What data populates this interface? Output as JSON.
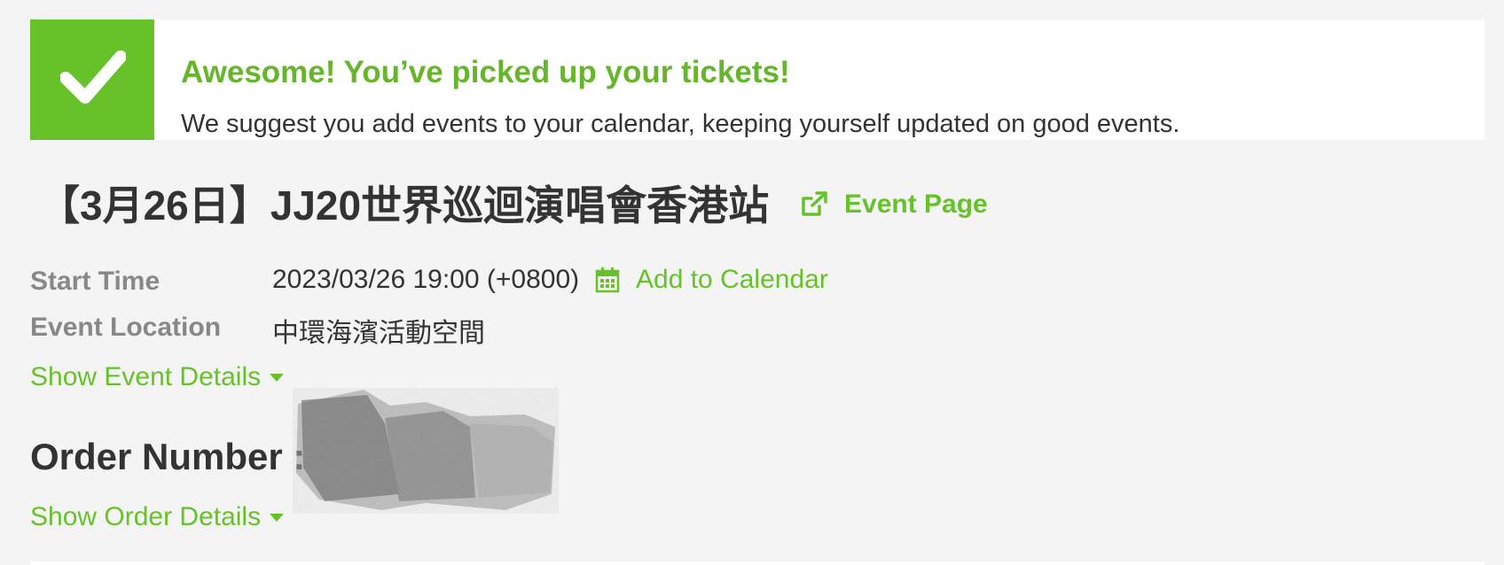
{
  "banner": {
    "heading": "Awesome! You’ve picked up your tickets!",
    "subtext": "We suggest you add events to your calendar, keeping yourself updated on good events.",
    "icon": "check-icon",
    "accent_color": "#67c22a"
  },
  "event": {
    "title": "【3月26日】JJ20世界巡迴演唱會香港站",
    "page_link_label": "Event Page",
    "page_link_icon": "external-link-icon"
  },
  "info": {
    "start_time_label": "Start Time",
    "start_time_value": "2023/03/26 19:00 (+0800)",
    "add_calendar_label": "Add to Calendar",
    "add_calendar_icon": "calendar-icon",
    "location_label": "Event Location",
    "location_value": "中環海濱活動空間"
  },
  "toggles": {
    "show_event_details": "Show Event Details",
    "show_order_details": "Show Order Details"
  },
  "order": {
    "number_label": "Order Number :"
  }
}
